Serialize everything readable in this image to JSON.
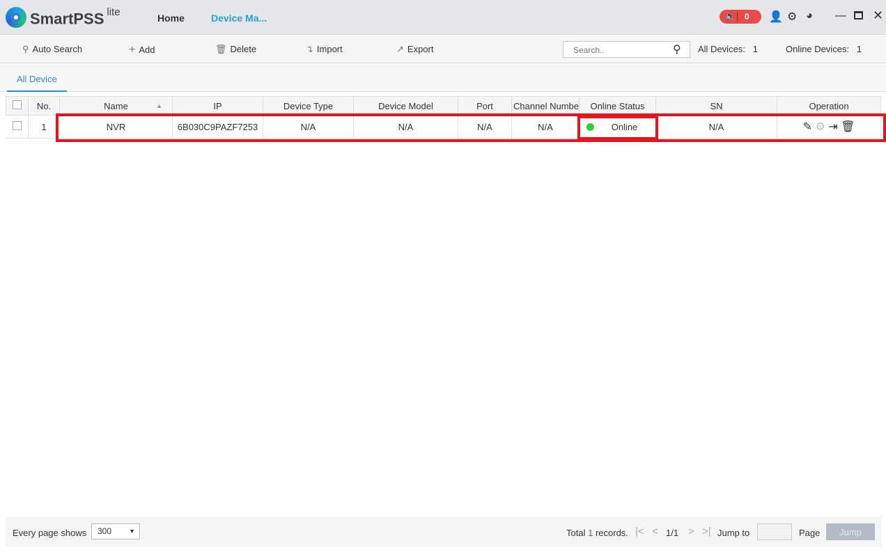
{
  "app": {
    "brand": "SmartPSS",
    "brand_suffix": "lite",
    "nav": [
      "Home",
      "Device Ma..."
    ],
    "alarm_count": "0"
  },
  "toolbar": {
    "auto_search": "Auto Search",
    "add": "Add",
    "delete": "Delete",
    "import": "Import",
    "export": "Export",
    "search_placeholder": "Search..",
    "all_devices_label": "All Devices:",
    "all_devices_count": "1",
    "online_devices_label": "Online Devices:",
    "online_devices_count": "1"
  },
  "tabs": [
    "All Device"
  ],
  "table": {
    "headers": [
      "No.",
      "Name",
      "IP",
      "Device Type",
      "Device Model",
      "Port",
      "Channel Numbe",
      "Online Status",
      "SN",
      "Operation"
    ],
    "rows": [
      {
        "no": "1",
        "name": "NVR",
        "ip": "6B030C9PAZF7253",
        "type": "N/A",
        "model": "N/A",
        "port": "N/A",
        "channel": "N/A",
        "status": "Online",
        "sn": "N/A"
      }
    ]
  },
  "footer": {
    "per_page_label": "Every page shows",
    "per_page": "300",
    "total_prefix": "Total",
    "total_count": "1",
    "total_suffix": "records.",
    "page": "1/1",
    "jump_to": "Jump to",
    "page_label": "Page",
    "jump": "Jump"
  },
  "colors": {
    "accent": "#2a8fd0",
    "online": "#2fd12f",
    "highlight": "#e8141b",
    "alarm": "#e84a4a"
  }
}
